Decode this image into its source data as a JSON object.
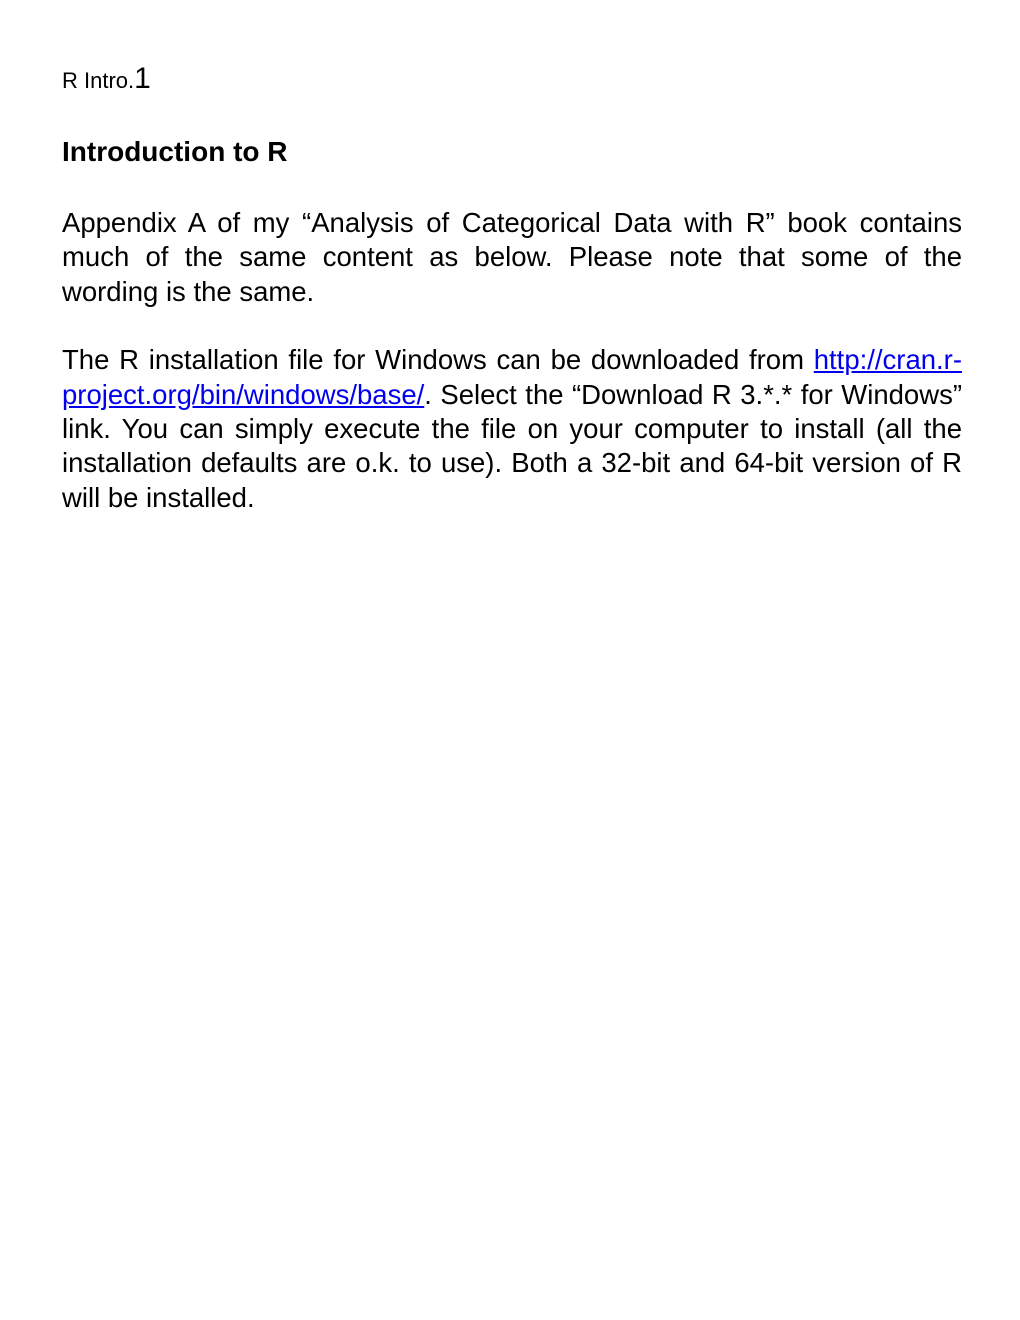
{
  "header": {
    "prefix": "R Intro.",
    "page_number": "1"
  },
  "title": "Introduction to R",
  "paragraphs": {
    "p1": "Appendix A of my “Analysis of Categorical Data with R” book contains much of the same content as below. Please note that some of the wording is the same.",
    "p2_before_link": "The R installation file for Windows can be downloaded from ",
    "p2_link": "http://cran.r-project.org/bin/windows/base/",
    "p2_after_link": ". Select the “Download R 3.*.* for Windows” link. You can simply execute the file on your computer to install (all the installation defaults are o.k. to use). Both a 32-bit and 64-bit version of R will be installed."
  }
}
